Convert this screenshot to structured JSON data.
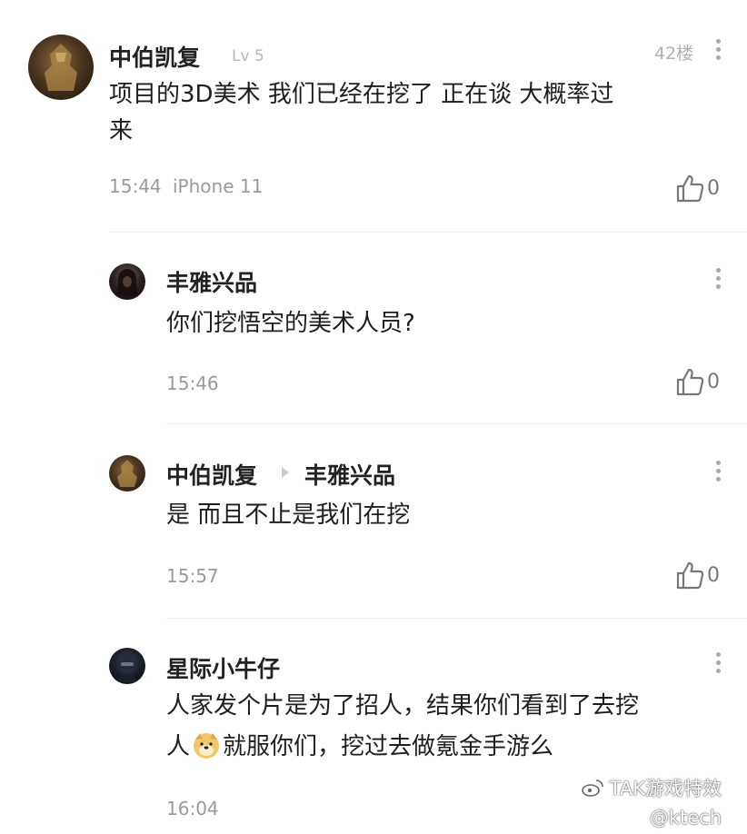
{
  "comments": [
    {
      "name": "中伯凯复",
      "level": "Lv 5",
      "floor": "42楼",
      "text_lines": [
        "项目的3D美术 我们已经在挖了 正在谈 大概率过",
        "来"
      ],
      "time": "15:44",
      "device": "iPhone 11",
      "likes": "0"
    },
    {
      "name": "丰雅兴品",
      "text_lines": [
        "你们挖悟空的美术人员?"
      ],
      "time": "15:46",
      "likes": "0"
    },
    {
      "name": "中伯凯复",
      "reply_to": "丰雅兴品",
      "text_lines": [
        "是 而且不止是我们在挖"
      ],
      "time": "15:57",
      "likes": "0"
    },
    {
      "name": "星际小牛仔",
      "text_lines": [
        "人家发个片是为了招人，结果你们看到了去挖",
        "人",
        "就服你们，挖过去做氪金手游么"
      ],
      "time": "16:04"
    }
  ],
  "watermark": {
    "line1": "TAK游戏特效",
    "line2": "@ktech"
  },
  "icons": {
    "like": "thumbs-up-icon",
    "more": "more-vertical-icon",
    "reply_arrow": "triangle-right-icon",
    "emoji": "doge-emoji-icon",
    "watermark": "weibo-icon"
  },
  "colors": {
    "text": "#1e1e1e",
    "muted": "#9a9a9a",
    "name": "#222222"
  }
}
